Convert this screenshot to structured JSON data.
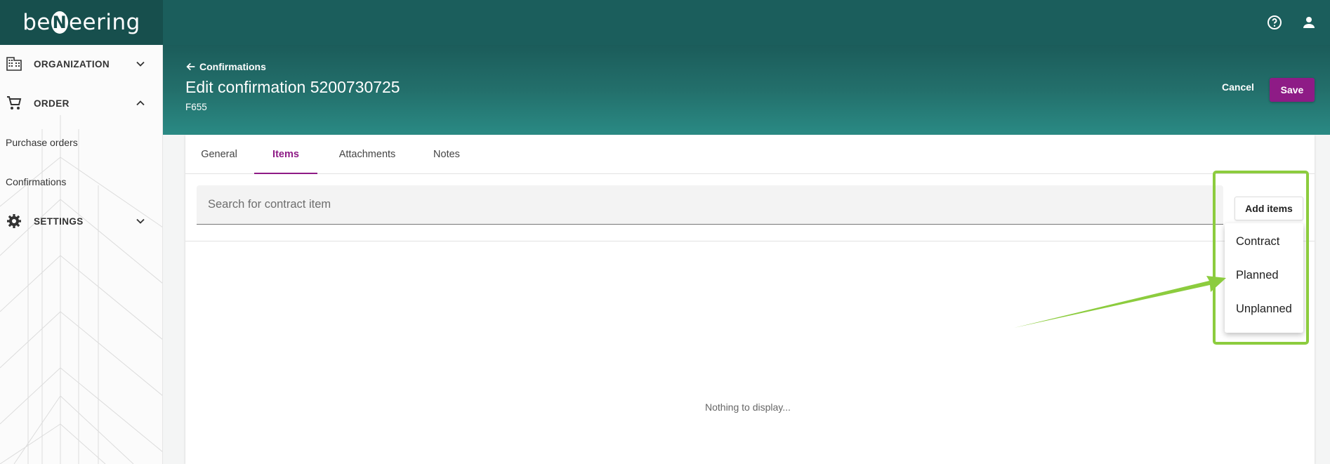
{
  "brand": {
    "logo_prefix": "be",
    "logo_mark": "N",
    "logo_suffix": "eering"
  },
  "topbar": {
    "help_icon": "help-circle-icon",
    "user_icon": "account-icon"
  },
  "sidebar": {
    "organization_label": "ORGANIZATION",
    "order_label": "ORDER",
    "purchase_orders_label": "Purchase orders",
    "confirmations_label": "Confirmations",
    "settings_label": "SETTINGS"
  },
  "header": {
    "back_label": "Confirmations",
    "title": "Edit confirmation 5200730725",
    "subtitle": "F655",
    "cancel_label": "Cancel",
    "save_label": "Save"
  },
  "tabs": {
    "general": "General",
    "items": "Items",
    "attachments": "Attachments",
    "notes": "Notes",
    "active": "Items"
  },
  "search": {
    "placeholder": "Search for contract item",
    "value": ""
  },
  "add_items": {
    "label": "Add items",
    "options": [
      "Contract",
      "Planned",
      "Unplanned"
    ]
  },
  "empty_state": "Nothing to display...",
  "colors": {
    "primary": "#1b5e5c",
    "accent": "#8e1b86",
    "highlight": "#8ccc3e"
  }
}
